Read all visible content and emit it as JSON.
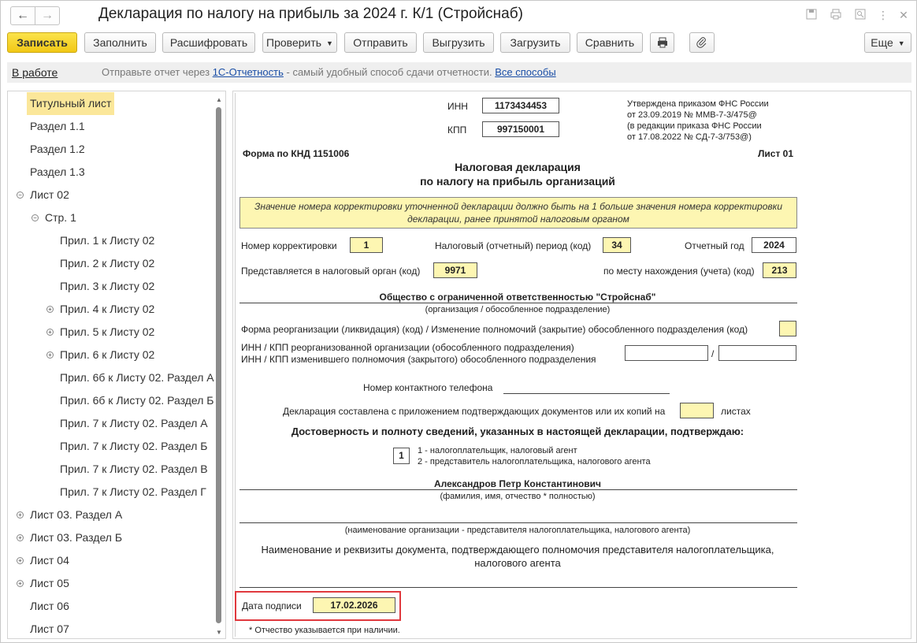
{
  "window": {
    "title": "Декларация по налогу на прибыль за 2024 г. К/1 (Стройснаб)"
  },
  "toolbar": {
    "save": "Записать",
    "fill": "Заполнить",
    "decode": "Расшифровать",
    "check": "Проверить",
    "send": "Отправить",
    "export": "Выгрузить",
    "import": "Загрузить",
    "compare": "Сравнить",
    "more": "Еще"
  },
  "status": {
    "state": "В работе",
    "msg_prefix": "Отправьте отчет через",
    "msg_link": "1С-Отчетность",
    "msg_suffix": "- самый удобный способ сдачи отчетности.",
    "all_ways": "Все способы"
  },
  "tree": {
    "items": [
      {
        "label": "Титульный лист"
      },
      {
        "label": "Раздел 1.1"
      },
      {
        "label": "Раздел 1.2"
      },
      {
        "label": "Раздел 1.3"
      },
      {
        "label": "Лист 02"
      },
      {
        "label": "Стр. 1"
      },
      {
        "label": "Прил. 1 к Листу 02"
      },
      {
        "label": "Прил. 2 к Листу 02"
      },
      {
        "label": "Прил. 3 к Листу 02"
      },
      {
        "label": "Прил. 4 к Листу 02"
      },
      {
        "label": "Прил. 5 к Листу 02"
      },
      {
        "label": "Прил. 6 к Листу 02"
      },
      {
        "label": "Прил. 6б к Листу 02. Раздел А"
      },
      {
        "label": "Прил. 6б к Листу 02. Раздел Б"
      },
      {
        "label": "Прил. 7 к Листу 02. Раздел А"
      },
      {
        "label": "Прил. 7 к Листу 02. Раздел Б"
      },
      {
        "label": "Прил. 7 к Листу 02. Раздел В"
      },
      {
        "label": "Прил. 7 к Листу 02. Раздел Г"
      },
      {
        "label": "Лист 03. Раздел А"
      },
      {
        "label": "Лист 03. Раздел Б"
      },
      {
        "label": "Лист 04"
      },
      {
        "label": "Лист 05"
      },
      {
        "label": "Лист 06"
      },
      {
        "label": "Лист 07"
      }
    ]
  },
  "doc": {
    "inn_label": "ИНН",
    "inn_value": "1173434453",
    "kpp_label": "КПП",
    "kpp_value": "997150001",
    "approved_1": "Утверждена приказом ФНС России",
    "approved_2": "от 23.09.2019 № ММВ-7-3/475@",
    "approved_3": "(в редакции приказа ФНС России",
    "approved_4": "от 17.08.2022 № СД-7-3/753@)",
    "form_knd": "Форма по КНД 1151006",
    "sheet": "Лист 01",
    "title_1": "Налоговая декларация",
    "title_2": "по налогу на прибыль организаций",
    "notice_1": "Значение номера корректировки уточненной декларации должно быть на 1 больше значения номера корректировки",
    "notice_2": "декларации, ранее принятой налоговым органом",
    "corr_label": "Номер корректировки",
    "corr_value": "1",
    "period_label": "Налоговый (отчетный) период (код)",
    "period_value": "34",
    "year_label": "Отчетный год",
    "year_value": "2024",
    "tax_org_label": "Представляется в налоговый орган (код)",
    "tax_org_value": "9971",
    "location_label": "по месту нахождения (учета) (код)",
    "location_value": "213",
    "org_name": "Общество с ограниченной ответственностью \"Стройснаб\"",
    "org_caption": "(организация / обособленное подразделение)",
    "reorg_label": "Форма реорганизации (ликвидация) (код) / Изменение полномочий (закрытие) обособленного подразделения (код)",
    "reorg_inn_1": "ИНН / КПП реорганизованной организации (обособленного подразделения)",
    "reorg_inn_2": "ИНН / КПП изменившего полномочия (закрытого) обособленного подразделения",
    "slash": "/",
    "phone_label": "Номер контактного телефона",
    "attach_label": "Декларация составлена с приложением подтверждающих документов или их копий на",
    "sheets_label": "листах",
    "confirm_title": "Достоверность и полноту сведений, указанных в настоящей декларации, подтверждаю:",
    "confirm_value": "1",
    "confirm_opt1": "1 - налогоплательщик, налоговый агент",
    "confirm_opt2": "2 - представитель налогоплательщика, налогового агента",
    "signer_name": "Александров Петр Константинович",
    "signer_caption": "(фамилия, имя, отчество *  полностью)",
    "rep_caption": "(наименование организации - представителя налогоплательщика, налогового агента)",
    "doc_req_1": "Наименование и реквизиты документа, подтверждающего полномочия представителя налогоплательщика,",
    "doc_req_2": "налогового агента",
    "sign_date_label": "Дата подписи",
    "sign_date_value": "17.02.2026",
    "footnote": "* Отчество указывается при наличии."
  }
}
